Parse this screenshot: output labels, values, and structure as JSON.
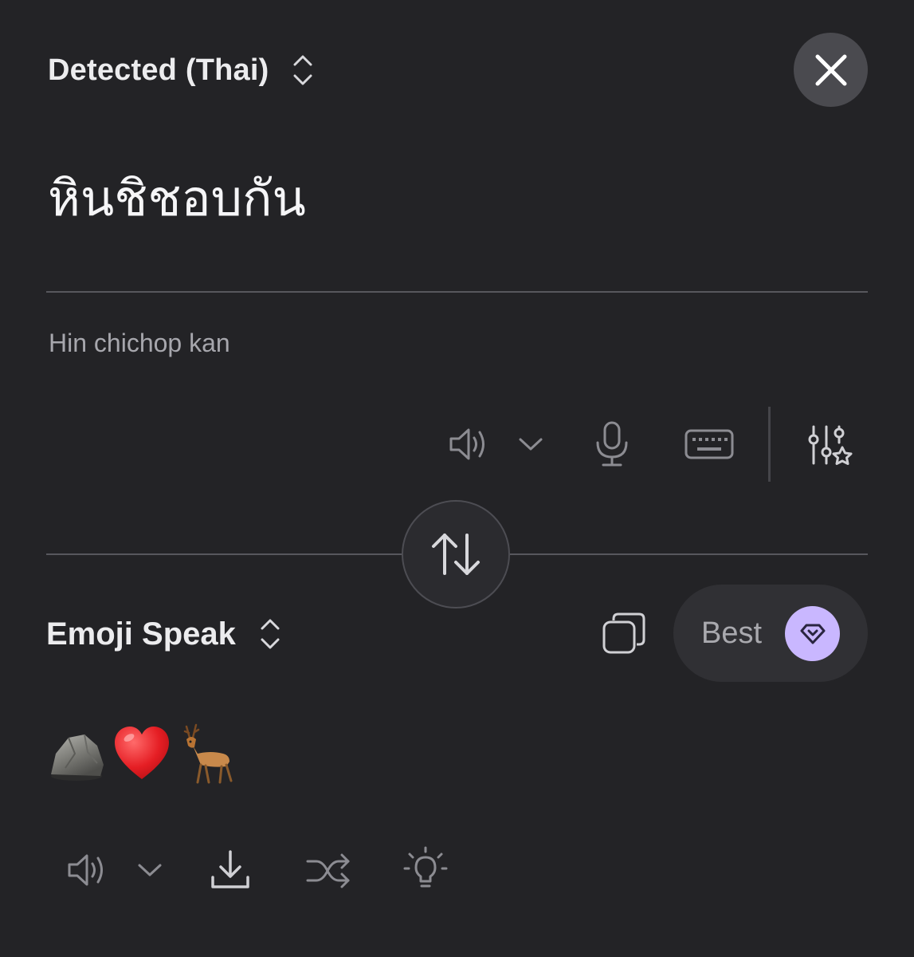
{
  "source": {
    "language_label": "Detected (Thai)",
    "text": "หินชิชอบกัน",
    "transliteration": "Hin chichop kan"
  },
  "target": {
    "language_label": "Emoji Speak",
    "quality_label": "Best",
    "output_emojis": [
      "rock",
      "red-heart",
      "deer"
    ]
  },
  "icons": {
    "source_toolbar": [
      "speaker-icon",
      "chevron-down-icon",
      "microphone-icon",
      "keyboard-icon",
      "settings-sliders-star-icon"
    ],
    "target_toolbar": [
      "speaker-icon",
      "chevron-down-icon",
      "download-icon",
      "shuffle-icon",
      "lightbulb-icon"
    ],
    "swap": "swap-arrows-icon",
    "copy": "copy-icon",
    "close": "close-icon",
    "badge": "diamond-icon"
  },
  "colors": {
    "background": "#232326",
    "accent_badge": "#c9b7ff",
    "close_bg": "#4a4a4f",
    "muted_icon": "#8c8c92"
  }
}
